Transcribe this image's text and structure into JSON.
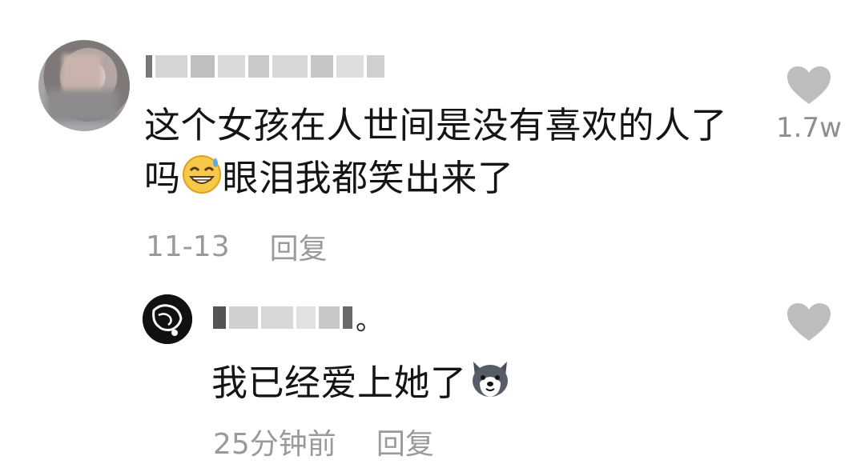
{
  "comments": [
    {
      "text_line1": "这个女孩在人世间是没有喜欢的人了",
      "text_line2_pre": "吗",
      "emoji": "grinning-sweat-emoji",
      "text_line2_post": "眼泪我都笑出来了",
      "date": "11-13",
      "reply_label": "回复",
      "like_count": "1.7w"
    },
    {
      "text_pre": "我已经爱上她了",
      "emoji": "husky-dog-emoji",
      "date": "25分钟前",
      "reply_label": "回复",
      "username_tail": "。"
    }
  ],
  "colors": {
    "text": "#141414",
    "meta": "#9a9a9a",
    "heart": "#bdbdbd"
  }
}
